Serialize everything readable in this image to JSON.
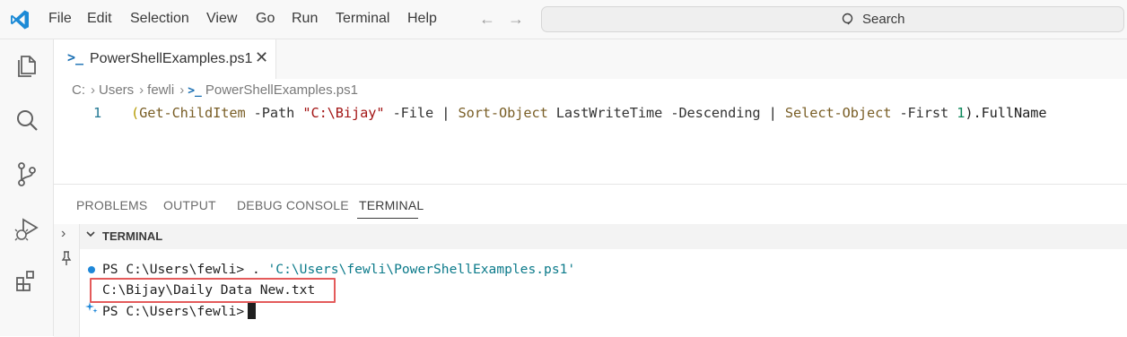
{
  "menu": [
    "File",
    "Edit",
    "Selection",
    "View",
    "Go",
    "Run",
    "Terminal",
    "Help"
  ],
  "search": {
    "label": "Search"
  },
  "tab": {
    "label": "PowerShellExamples.ps1",
    "close": "✕"
  },
  "breadcrumb": {
    "drive": "C:",
    "users": "Users",
    "user": "fewli",
    "file": "PowerShellExamples.ps1"
  },
  "editor": {
    "line_number": "1",
    "tokens": {
      "open": "(",
      "cmd1": "Get-ChildItem",
      "p1": " -Path ",
      "str1": "\"C:\\Bijay\"",
      "p2": " -File ",
      "pipe1": "| ",
      "cmd2": "Sort-Object",
      "p3": " LastWriteTime -Descending ",
      "pipe2": "| ",
      "cmd3": "Select-Object",
      "p4": " -First ",
      "num": "1",
      "close": ").FullName"
    }
  },
  "panel": {
    "tabs": [
      "PROBLEMS",
      "OUTPUT",
      "DEBUG CONSOLE",
      "TERMINAL"
    ],
    "active_tab": "TERMINAL",
    "section_title": "TERMINAL"
  },
  "terminal": {
    "line1_prompt": "PS C:\\Users\\fewli> ",
    "line1_cmd": ". ",
    "line1_str": "'C:\\Users\\fewli\\PowerShellExamples.ps1'",
    "line2_output": "C:\\Bijay\\Daily Data New.txt",
    "line3_prompt": "PS C:\\Users\\fewli>"
  },
  "colors": {
    "accent": "#1e87d8",
    "highlight_box": "#e45b5b"
  }
}
